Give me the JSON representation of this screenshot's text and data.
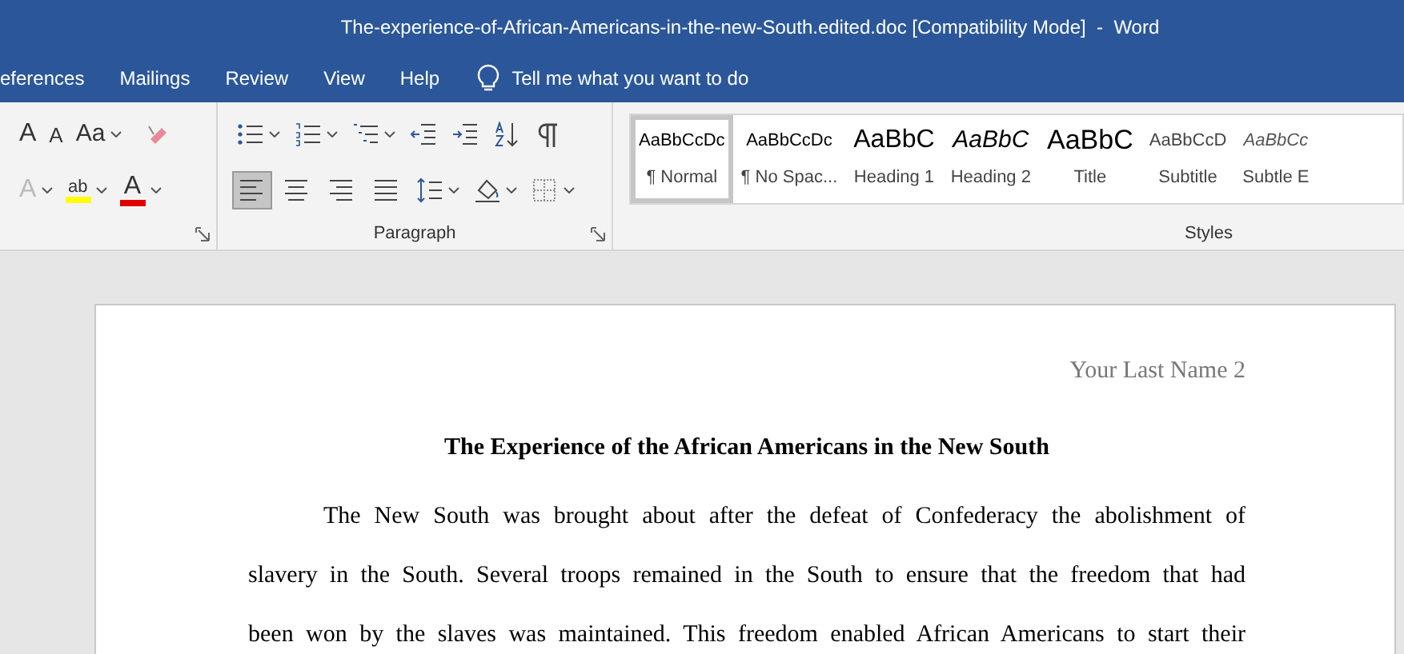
{
  "window": {
    "title": "The-experience-of-African-Americans-in-the-new-South.edited.doc [Compatibility Mode]  -  Word"
  },
  "tabs": [
    {
      "label": "eferences",
      "selected": false
    },
    {
      "label": "Mailings",
      "selected": false
    },
    {
      "label": "Review",
      "selected": false
    },
    {
      "label": "View",
      "selected": false
    },
    {
      "label": "Help",
      "selected": false
    }
  ],
  "tell_me": {
    "placeholder": "Tell me what you want to do"
  },
  "font_group": {
    "row_1": [
      {
        "kind": "grow",
        "label": "A"
      },
      {
        "kind": "shrink",
        "label": "A"
      },
      {
        "kind": "case",
        "label": "Aa"
      },
      {
        "kind": "clear"
      }
    ],
    "row_2": [
      {
        "kind": "effects",
        "label": "A",
        "disabled": true
      },
      {
        "kind": "highlight",
        "label": "ab",
        "color": "#ffff00"
      },
      {
        "kind": "fontcolor",
        "label": "A",
        "color": "#e00000"
      }
    ]
  },
  "paragraph_group": {
    "label": "Paragraph",
    "row_1": [
      {
        "kind": "bullets"
      },
      {
        "kind": "numbering"
      },
      {
        "kind": "multilevel"
      },
      {
        "kind": "outdent"
      },
      {
        "kind": "indent"
      },
      {
        "kind": "sort"
      },
      {
        "kind": "pilcrow"
      }
    ],
    "row_2": [
      {
        "kind": "align-left",
        "selected": true
      },
      {
        "kind": "align-center",
        "selected": false
      },
      {
        "kind": "align-right",
        "selected": false
      },
      {
        "kind": "justify",
        "selected": false
      },
      {
        "kind": "spacing"
      },
      {
        "kind": "shading"
      },
      {
        "kind": "borders"
      }
    ]
  },
  "styles_group": {
    "label": "Styles",
    "items": [
      {
        "preview": "AaBbCcDc",
        "label": "¶ Normal",
        "kind": "normal",
        "selected": true
      },
      {
        "preview": "AaBbCcDc",
        "label": "¶ No Spac...",
        "kind": "normal",
        "selected": false
      },
      {
        "preview": "AaBbC",
        "label": "Heading 1",
        "kind": "heading1",
        "selected": false
      },
      {
        "preview": "AaBbC",
        "label": "Heading 2",
        "kind": "heading2",
        "selected": false
      },
      {
        "preview": "AaBbC",
        "label": "Title",
        "kind": "title",
        "selected": false
      },
      {
        "preview": "AaBbCcD",
        "label": "Subtitle",
        "kind": "subtitle",
        "selected": false
      },
      {
        "preview": "AaBbCc",
        "label": "Subtle E",
        "kind": "emphasis",
        "selected": false
      }
    ]
  },
  "document": {
    "header": "Your Last Name 2",
    "heading": "The Experience of the African Americans in the New South",
    "lines": [
      {
        "text": "The New South was brought about after the defeat of Confederacy the abolishment of",
        "indent": true
      },
      {
        "text": "slavery in the South. Several troops remained in the South to ensure that the freedom that had",
        "indent": false
      },
      {
        "text": "been won by the slaves was maintained. This freedom enabled African Americans to start their",
        "indent": false
      }
    ]
  }
}
